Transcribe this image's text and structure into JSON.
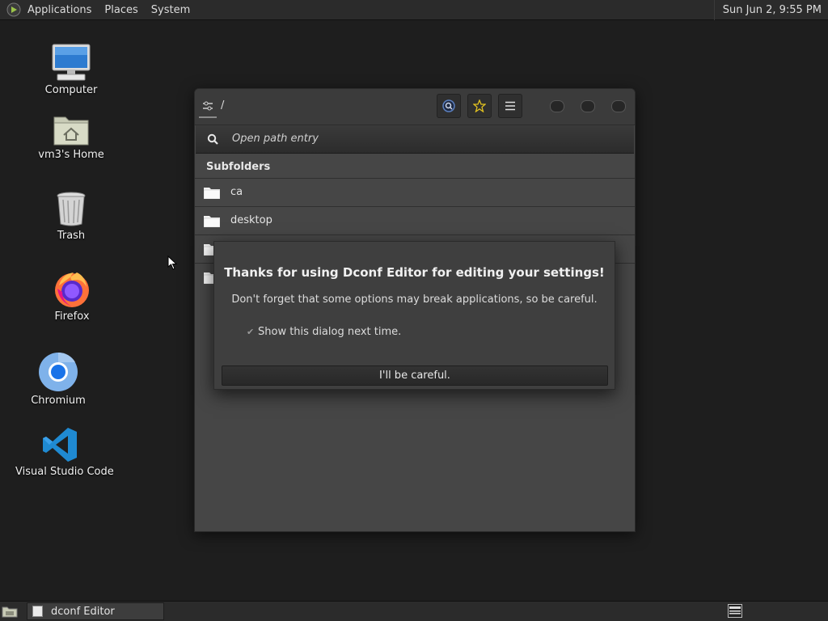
{
  "top_panel": {
    "menus": [
      "Applications",
      "Places",
      "System"
    ],
    "clock": "Sun Jun  2,  9:55 PM"
  },
  "desktop": {
    "icons": [
      {
        "label": "Computer",
        "icon": "computer-icon"
      },
      {
        "label": "vm3's Home",
        "icon": "home-folder-icon"
      },
      {
        "label": "Trash",
        "icon": "trash-icon"
      },
      {
        "label": "Firefox",
        "icon": "firefox-icon"
      },
      {
        "label": "Chromium",
        "icon": "chromium-icon"
      },
      {
        "label": "Visual Studio Code",
        "icon": "vscode-icon"
      }
    ]
  },
  "window": {
    "path": "/",
    "search_placeholder": "Open path entry",
    "section_title": "Subfolders",
    "folders": [
      "ca",
      "desktop"
    ]
  },
  "dialog": {
    "title": "Thanks for using Dconf Editor for editing your settings!",
    "message": "Don't forget that some options may break applications, so be careful.",
    "checkbox_label": "Show this dialog next time.",
    "checkbox_checked": true,
    "button_label": "I'll be careful."
  },
  "taskbar": {
    "task_label": "dconf Editor"
  },
  "colors": {
    "desktop_bg": "#1e1e1e",
    "panel_bg": "#2b2b2b",
    "window_bg": "#464646",
    "star_accent": "#e0c020"
  }
}
